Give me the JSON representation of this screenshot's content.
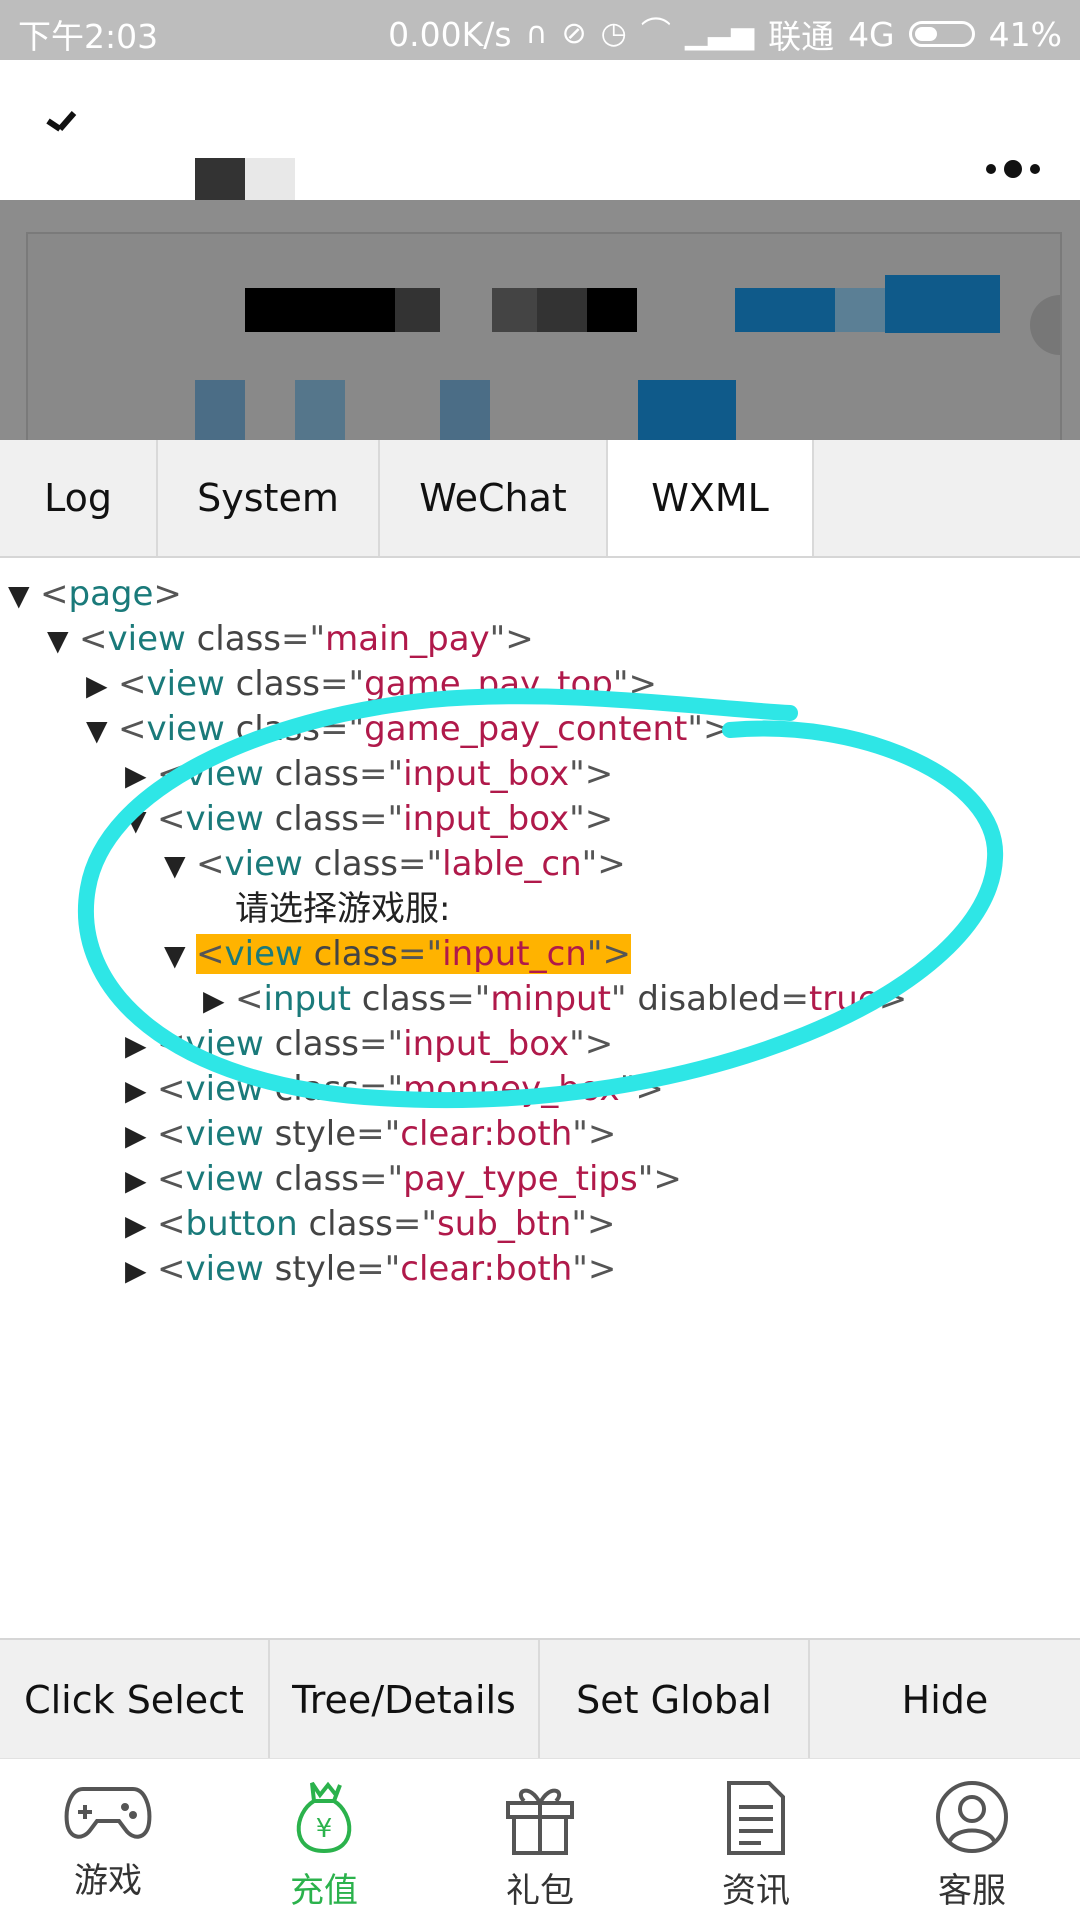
{
  "status_bar": {
    "time": "下午2:03",
    "speed": "0.00K/s",
    "carrier": "联通",
    "network": "4G",
    "battery": "41%",
    "battery_level": 0.41
  },
  "tabs": [
    {
      "label": "Log",
      "active": false
    },
    {
      "label": "System",
      "active": false
    },
    {
      "label": "WeChat",
      "active": false
    },
    {
      "label": "WXML",
      "active": true
    }
  ],
  "tree": [
    {
      "arrow": "down",
      "indent": 0,
      "tag": "page",
      "attrs": []
    },
    {
      "arrow": "down",
      "indent": 1,
      "tag": "view",
      "attrs": [
        {
          "name": "class",
          "value": "main_pay"
        }
      ]
    },
    {
      "arrow": "right",
      "indent": 2,
      "tag": "view",
      "attrs": [
        {
          "name": "class",
          "value": "game_pay_top"
        }
      ]
    },
    {
      "arrow": "down",
      "indent": 2,
      "tag": "view",
      "attrs": [
        {
          "name": "class",
          "value": "game_pay_content"
        }
      ]
    },
    {
      "arrow": "right",
      "indent": 3,
      "tag": "view",
      "attrs": [
        {
          "name": "class",
          "value": "input_box"
        }
      ]
    },
    {
      "arrow": "down",
      "indent": 3,
      "tag": "view",
      "attrs": [
        {
          "name": "class",
          "value": "input_box"
        }
      ]
    },
    {
      "arrow": "down",
      "indent": 4,
      "tag": "view",
      "attrs": [
        {
          "name": "class",
          "value": "lable_cn"
        }
      ]
    },
    {
      "arrow": "none",
      "indent": 5,
      "text": "请选择游戏服:"
    },
    {
      "arrow": "down",
      "indent": 4,
      "tag": "view",
      "attrs": [
        {
          "name": "class",
          "value": "input_cn"
        }
      ],
      "highlighted": true
    },
    {
      "arrow": "right",
      "indent": 5,
      "tag": "input",
      "attrs": [
        {
          "name": "class",
          "value": "minput"
        },
        {
          "name": "disabled",
          "value": "true",
          "bare": true
        }
      ]
    },
    {
      "arrow": "right",
      "indent": 3,
      "tag": "view",
      "attrs": [
        {
          "name": "class",
          "value": "input_box"
        }
      ]
    },
    {
      "arrow": "right",
      "indent": 3,
      "tag": "view",
      "attrs": [
        {
          "name": "class",
          "value": "monney_box"
        }
      ]
    },
    {
      "arrow": "right",
      "indent": 3,
      "tag": "view",
      "attrs": [
        {
          "name": "style",
          "value": "clear:both"
        }
      ]
    },
    {
      "arrow": "right",
      "indent": 3,
      "tag": "view",
      "attrs": [
        {
          "name": "class",
          "value": "pay_type_tips"
        }
      ]
    },
    {
      "arrow": "right",
      "indent": 3,
      "tag": "button",
      "attrs": [
        {
          "name": "class",
          "value": "sub_btn"
        }
      ]
    },
    {
      "arrow": "right",
      "indent": 3,
      "tag": "view",
      "attrs": [
        {
          "name": "style",
          "value": "clear:both"
        }
      ]
    }
  ],
  "debug_buttons": [
    "Click Select",
    "Tree/Details",
    "Set Global",
    "Hide"
  ],
  "app_tabs": [
    {
      "label": "游戏",
      "icon": "gamepad-icon",
      "active": false
    },
    {
      "label": "充值",
      "icon": "money-bag-icon",
      "active": true
    },
    {
      "label": "礼包",
      "icon": "gift-icon",
      "active": false
    },
    {
      "label": "资讯",
      "icon": "document-icon",
      "active": false
    },
    {
      "label": "客服",
      "icon": "user-service-icon",
      "active": false
    }
  ],
  "colors": {
    "tag": "#1a7a7a",
    "attr_value": "#b0194a",
    "highlight": "#ffb300",
    "active_tab": "#2bb24c",
    "annotation": "#2ee6e6"
  }
}
